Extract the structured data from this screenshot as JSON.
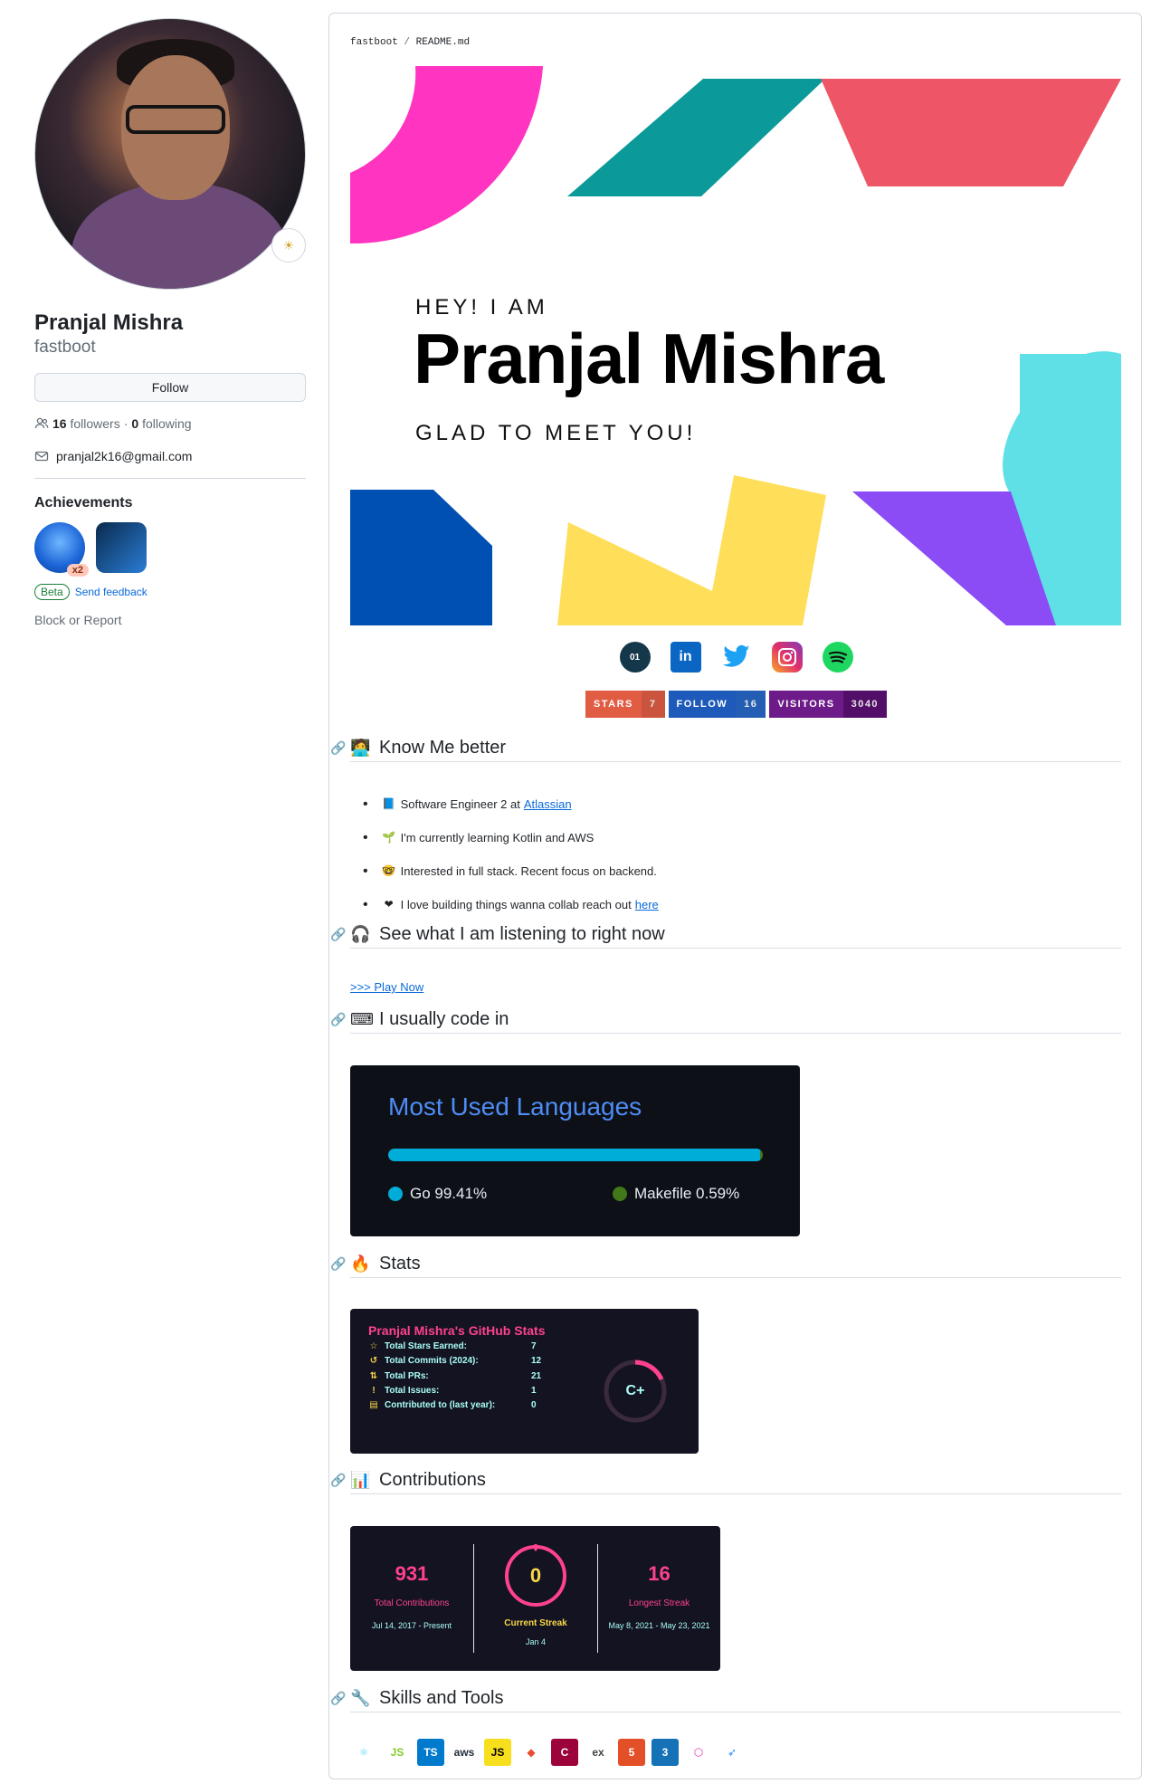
{
  "profile": {
    "name": "Pranjal Mishra",
    "login": "fastboot",
    "follow_label": "Follow",
    "followers_count": "16",
    "followers_label": "followers",
    "following_count": "0",
    "following_label": "following",
    "separator": "·",
    "email": "pranjal2k16@gmail.com",
    "achievements_title": "Achievements",
    "achievement_multiplier": "x2",
    "beta_label": "Beta",
    "feedback_label": "Send feedback",
    "block_report": "Block or Report"
  },
  "readme": {
    "crumb_repo": "fastboot",
    "crumb_sep": "/",
    "crumb_file": "README.md",
    "banner": {
      "greeting": "HEY! I AM",
      "name": "Pranjal Mishra",
      "tagline": "GLAD TO MEET YOU!"
    },
    "social_icons": [
      "code-icon",
      "linkedin-icon",
      "twitter-icon",
      "instagram-icon",
      "spotify-icon"
    ],
    "shields": [
      {
        "label": "STARS",
        "value": "7",
        "left_color": "#e05d44",
        "right_color": "#e05d44"
      },
      {
        "label": "FOLLOW",
        "value": "16",
        "left_color": "#1e5ab9",
        "right_color": "#2867c8"
      },
      {
        "label": "VISITORS",
        "value": "3040",
        "left_color": "#6e1b8a",
        "right_color": "#5b0f74"
      }
    ],
    "sections": {
      "know": {
        "emoji": "🧑‍💻",
        "title": "Know Me better"
      },
      "listening": {
        "emoji": "🎧",
        "title": "See what I am listening to right now"
      },
      "code": {
        "emoji": "⌨",
        "title": "I usually code in"
      },
      "stats": {
        "emoji": "🔥",
        "title": "Stats"
      },
      "contrib": {
        "emoji": "📊",
        "title": "Contributions"
      },
      "skills": {
        "emoji": "🔧",
        "title": "Skills and Tools"
      }
    },
    "bullets": [
      {
        "emoji": "📘",
        "text": "Software Engineer 2 at",
        "link": "Atlassian"
      },
      {
        "emoji": "🌱",
        "text": "I'm currently learning Kotlin and AWS",
        "link": ""
      },
      {
        "emoji": "🤓",
        "text": "Interested in full stack. Recent focus on backend.",
        "link": ""
      },
      {
        "emoji": "❤",
        "text": "I love building things wanna collab reach out",
        "link": "here"
      }
    ],
    "play_now": ">>> Play Now",
    "languages": {
      "title": "Most Used Languages",
      "items": [
        {
          "name": "Go 99.41%",
          "percent": 99.41,
          "color": "#00add8"
        },
        {
          "name": "Makefile 0.59%",
          "percent": 0.59,
          "color": "#427819"
        }
      ]
    },
    "stats_card": {
      "title": "Pranjal Mishra's GitHub Stats",
      "rows": [
        {
          "icon": "star-icon",
          "glyph": "☆",
          "label": "Total Stars Earned:",
          "value": "7"
        },
        {
          "icon": "commits-icon",
          "glyph": "↺",
          "label": "Total Commits (2024):",
          "value": "12"
        },
        {
          "icon": "pr-icon",
          "glyph": "⇅",
          "label": "Total PRs:",
          "value": "21"
        },
        {
          "icon": "issue-icon",
          "glyph": "!",
          "label": "Total Issues:",
          "value": "1"
        },
        {
          "icon": "repo-icon",
          "glyph": "▤",
          "label": "Contributed to (last year):",
          "value": "0"
        }
      ],
      "rank": "C+"
    },
    "streak": {
      "total": "931",
      "total_label": "Total Contributions",
      "total_range": "Jul 14, 2017 - Present",
      "current": "0",
      "current_label": "Current Streak",
      "current_range": "Jan 4",
      "longest": "16",
      "longest_label": "Longest Streak",
      "longest_range": "May 8, 2021 - May 23, 2021"
    },
    "skills": [
      {
        "name": "react-icon",
        "glyph": "⚛",
        "color": "#61dafb",
        "bg": "#ffffff",
        "label": ""
      },
      {
        "name": "nodejs-icon",
        "glyph": "JS",
        "color": "#83cd29",
        "bg": "#ffffff",
        "label": ""
      },
      {
        "name": "typescript-icon",
        "glyph": "TS",
        "color": "#ffffff",
        "bg": "#007acc",
        "label": ""
      },
      {
        "name": "aws-icon",
        "glyph": "aws",
        "color": "#252f3e",
        "bg": "#ffffff",
        "label": ""
      },
      {
        "name": "javascript-icon",
        "glyph": "JS",
        "color": "#000000",
        "bg": "#f7df1e",
        "label": ""
      },
      {
        "name": "git-icon",
        "glyph": "◆",
        "color": "#e94e31",
        "bg": "#ffffff",
        "label": ""
      },
      {
        "name": "cplusplus-icon",
        "glyph": "C",
        "color": "#ffffff",
        "bg": "#9c033a",
        "label": ""
      },
      {
        "name": "express-icon",
        "glyph": "ex",
        "color": "#444444",
        "bg": "#ffffff",
        "label": ""
      },
      {
        "name": "html5-icon",
        "glyph": "5",
        "color": "#ffffff",
        "bg": "#e34f26",
        "label": ""
      },
      {
        "name": "css3-icon",
        "glyph": "3",
        "color": "#ffffff",
        "bg": "#1572b6",
        "label": ""
      },
      {
        "name": "graphql-icon",
        "glyph": "⬡",
        "color": "#e535ab",
        "bg": "#ffffff",
        "label": ""
      },
      {
        "name": "jira-icon",
        "glyph": "➶",
        "color": "#2684ff",
        "bg": "#ffffff",
        "label": ""
      }
    ]
  }
}
